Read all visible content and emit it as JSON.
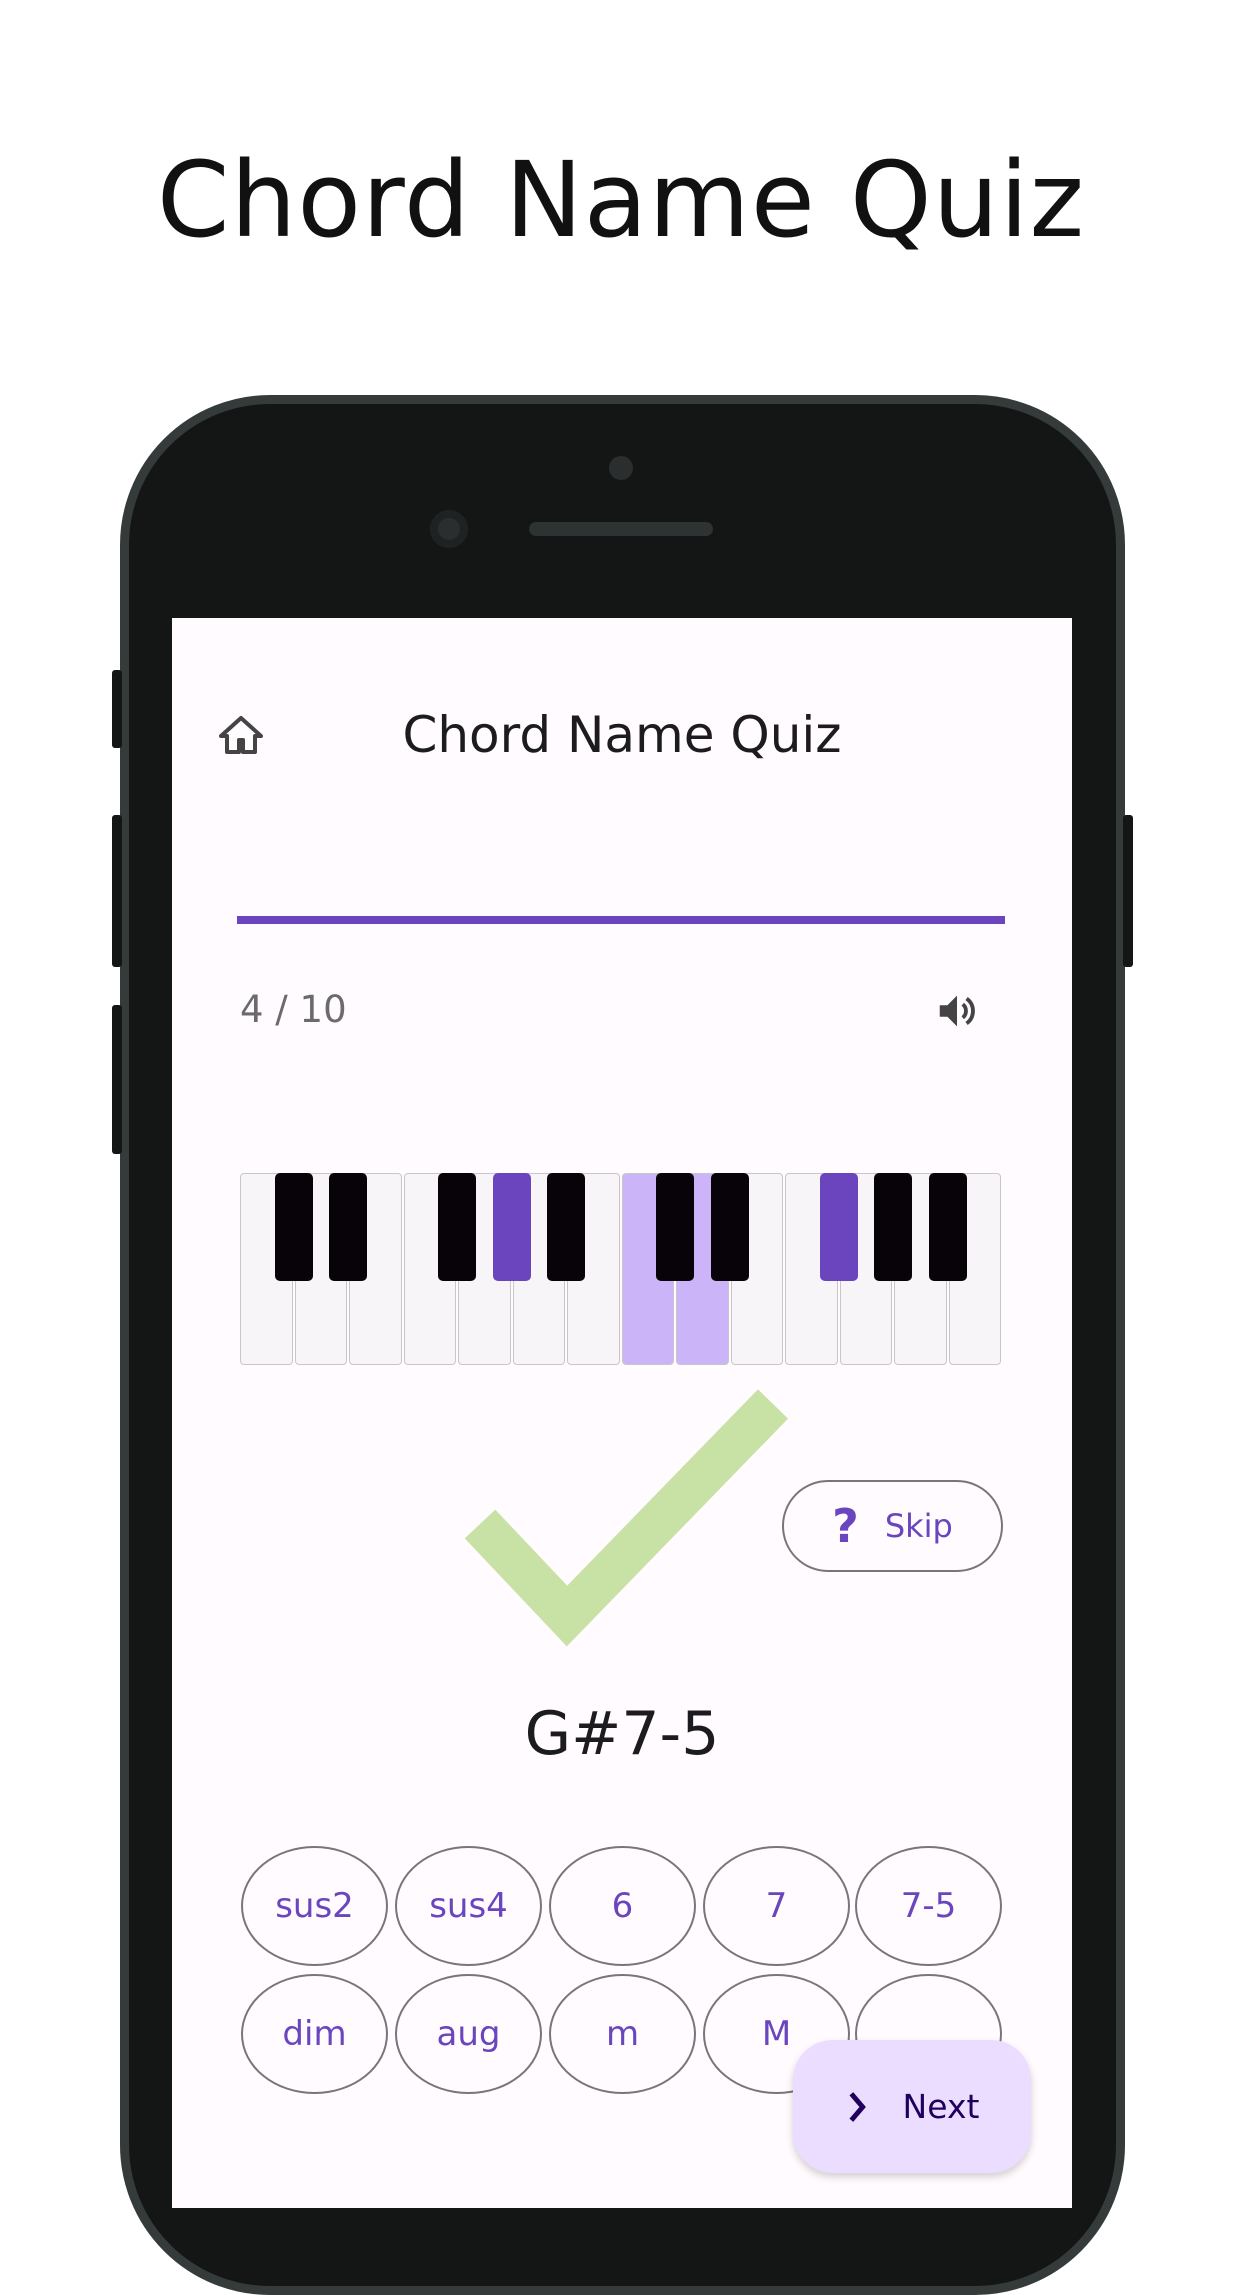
{
  "headline": "Chord Name Quiz",
  "app": {
    "title": "Chord Name Quiz",
    "home_icon": "home-icon",
    "progress": 1.0,
    "counter": "4 / 10",
    "sound_icon": "volume-icon",
    "accent": "#6a45bd",
    "highlight": "#cbb5f8",
    "piano": {
      "white_keys": [
        "C",
        "D",
        "E",
        "F",
        "G",
        "A",
        "B",
        "C",
        "D",
        "E",
        "F",
        "G",
        "A",
        "B"
      ],
      "black_keys": [
        "C#",
        "D#",
        "F#",
        "G#",
        "A#",
        "C#",
        "D#",
        "F#",
        "G#",
        "A#"
      ],
      "highlighted_white": [
        7,
        8
      ],
      "highlighted_black": [
        3,
        7
      ]
    },
    "result_icon": "check-icon",
    "result_color": "#c8e2a5",
    "skip_label": "Skip",
    "skip_icon": "question-icon",
    "chord_name": "G#7-5",
    "chord_options": [
      "sus2",
      "sus4",
      "6",
      "7",
      "7-5",
      "dim",
      "aug",
      "m",
      "M",
      ""
    ],
    "next_label": "Next",
    "next_icon": "chevron-right-icon"
  }
}
